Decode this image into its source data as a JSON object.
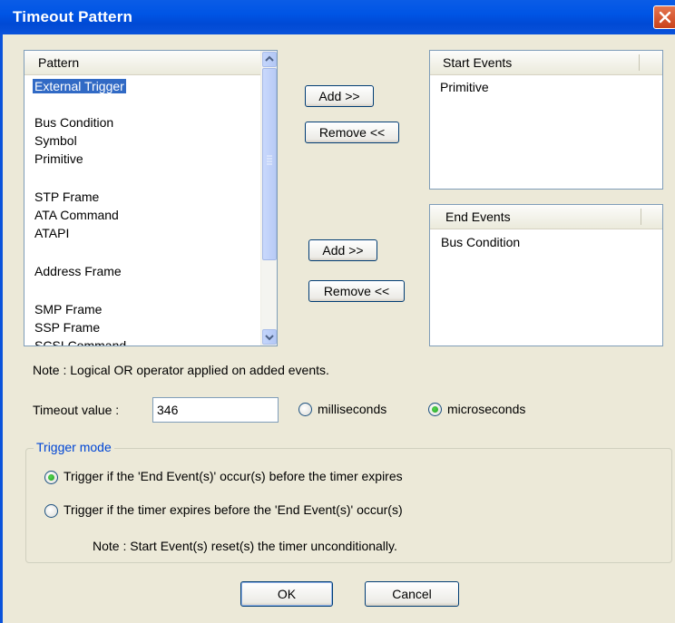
{
  "window": {
    "title": "Timeout Pattern"
  },
  "pattern_list": {
    "header": "Pattern",
    "items": [
      {
        "label": "External Trigger",
        "selected": true
      },
      {
        "label": "Bus Condition"
      },
      {
        "label": "Symbol"
      },
      {
        "label": "Primitive"
      },
      {
        "label": "STP Frame"
      },
      {
        "label": "ATA Command"
      },
      {
        "label": "ATAPI"
      },
      {
        "label": "Address Frame"
      },
      {
        "label": "SMP Frame"
      },
      {
        "label": "SSP Frame"
      },
      {
        "label": "SCSI Command"
      }
    ]
  },
  "start_events": {
    "header": "Start Events",
    "items": [
      "Primitive"
    ],
    "add_label": "Add >>",
    "remove_label": "Remove <<"
  },
  "end_events": {
    "header": "End Events",
    "items": [
      "Bus Condition"
    ],
    "add_label": "Add >>",
    "remove_label": "Remove <<"
  },
  "note_or": "Note : Logical OR operator applied on added events.",
  "timeout": {
    "label": "Timeout value :",
    "value": "346",
    "unit_options": [
      "milliseconds",
      "microseconds"
    ],
    "selected_unit": "microseconds"
  },
  "trigger_mode": {
    "title": "Trigger mode",
    "options": [
      "Trigger if the 'End Event(s)' occur(s) before the timer expires",
      "Trigger if the timer expires before the 'End Event(s)' occur(s)"
    ],
    "selected_index": 0,
    "note": "Note : Start Event(s) reset(s) the timer unconditionally."
  },
  "buttons": {
    "ok": "OK",
    "cancel": "Cancel"
  },
  "colors": {
    "titlebar": "#0055e5",
    "dialog_bg": "#ece9d8",
    "selection": "#316ac5",
    "group_title": "#0046d5",
    "close_button": "#d9552d"
  }
}
